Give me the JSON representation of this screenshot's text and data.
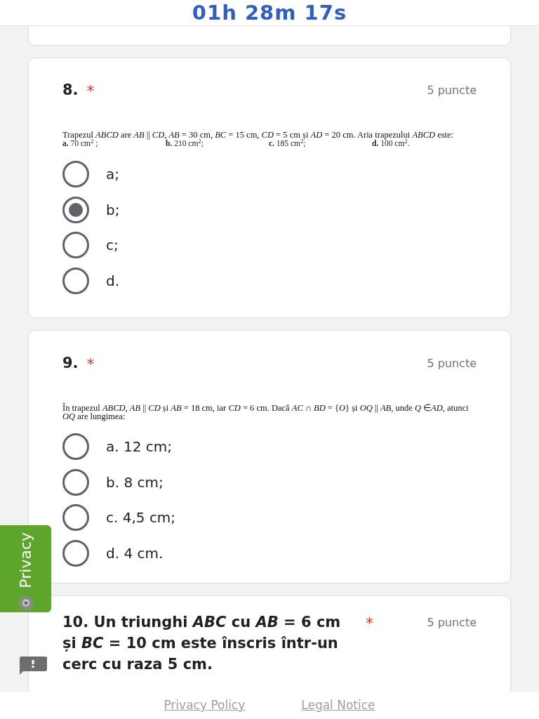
{
  "timer": "01h 28m 17s",
  "questions": [
    {
      "title": "8.",
      "required_mark": "*",
      "points": "5 puncte",
      "text": "Trapezul *ABCD* are *AB* || *CD*, *AB* = 30 cm, *BC* = 15 cm, *CD* = 5 cm și *AD* = 20 cm. Aria trapezului *ABCD* este:",
      "choices": [
        "**a.** 70 cm$^{2}$ ;",
        "**b.** 210 cm$^{2}$;",
        "**c.** 185 cm$^{2}$;",
        "**d.** 100 cm$^{2}$."
      ],
      "options": [
        {
          "label": "a;",
          "selected": false
        },
        {
          "label": "b;",
          "selected": true
        },
        {
          "label": "c;",
          "selected": false
        },
        {
          "label": "d.",
          "selected": false
        }
      ]
    },
    {
      "title": "9.",
      "required_mark": "*",
      "points": "5 puncte",
      "text": "În trapezul *ABCD*, *AB* || *CD* și *AB* = 18 cm, iar *CD* = 6 cm. Dacă *AC* ∩ *BD* = {*O*} și *OQ* || *AB*, unde *Q* ∈*AD*, atunci *OQ* are lungimea:",
      "options": [
        {
          "label": "a. 12 cm;",
          "selected": false
        },
        {
          "label": "b. 8 cm;",
          "selected": false
        },
        {
          "label": "c. 4,5 cm;",
          "selected": false
        },
        {
          "label": "d. 4 cm.",
          "selected": false
        }
      ]
    },
    {
      "title": "10. Un triunghi *ABC* cu *AB* = 6 cm și *BC* = 10 cm este înscris într-un cerc cu raza 5 cm.",
      "required_mark": "*",
      "points": "5 puncte"
    }
  ],
  "privacy_tab": {
    "label": "Privacy"
  },
  "footer_links": [
    "Privacy Policy",
    "Legal Notice"
  ]
}
